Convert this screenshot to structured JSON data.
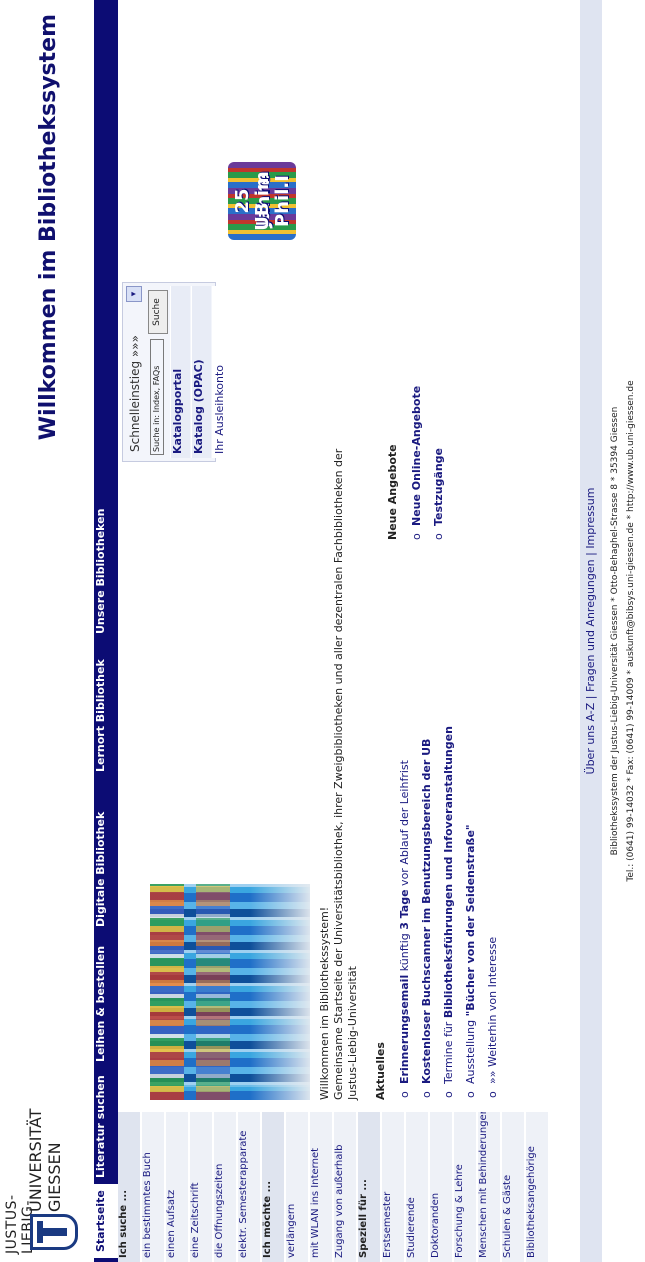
{
  "header": {
    "logo_line1": "JUSTUS-LIEBIG-",
    "logo_line2": "UNIVERSITÄT",
    "logo_line3": "GIESSEN",
    "site_title": "Willkommen im Bibliothekssystem"
  },
  "nav": {
    "tabs": [
      {
        "label": "Startseite"
      },
      {
        "label": "Literatur suchen"
      },
      {
        "label": "Leihen & bestellen"
      },
      {
        "label": "Digitale Bibliothek"
      },
      {
        "label": "Lernort Bibliothek"
      },
      {
        "label": "Unsere Bibliotheken"
      }
    ]
  },
  "sidebar": {
    "items": [
      {
        "label": "Ich suche ..."
      },
      {
        "label": "ein bestimmtes Buch"
      },
      {
        "label": "einen Aufsatz"
      },
      {
        "label": "eine Zeitschrift"
      },
      {
        "label": "die Öffnungszeiten"
      },
      {
        "label": "elektr. Semesterapparate"
      },
      {
        "label": "Ich möchte ..."
      },
      {
        "label": "verlängern"
      },
      {
        "label": "mit WLAN ins Internet"
      },
      {
        "label": "Zugang von außerhalb"
      },
      {
        "label": "Speziell für ..."
      },
      {
        "label": "Erstsemester"
      },
      {
        "label": "Studierende"
      },
      {
        "label": "Doktoranden"
      },
      {
        "label": "Forschung & Lehre"
      },
      {
        "label": "Menschen mit Behinderungen"
      },
      {
        "label": "Schulen & Gäste"
      },
      {
        "label": "Bibliotheksangehörige"
      }
    ]
  },
  "main": {
    "intro_line1": "Willkommen im Bibliothekssystem!",
    "intro_line2": "Gemeinsame Startseite der Universitätsbibliothek, ihrer Zweigbibliotheken und aller dezentralen Fachbibliotheken der",
    "intro_line3": "Justus-Liebig-Universität",
    "news_heading": "Aktuelles",
    "news": [
      {
        "bold": "Erinnerungsemail",
        "mid": " künftig ",
        "bold2": "3 Tage",
        "rest": " vor Ablauf der Leihfrist"
      },
      {
        "bold": "Kostenloser Buchscanner im Benutzungsbereich der UB",
        "mid": "",
        "bold2": "",
        "rest": ""
      },
      {
        "bold": "",
        "mid": "Termine für ",
        "bold2": "Bibliotheksführungen und Infoveranstaltungen",
        "rest": ""
      },
      {
        "bold": "",
        "mid": "Ausstellung ",
        "bold2": "\"Bücher von der Seidenstraße\"",
        "rest": ""
      },
      {
        "bold": "",
        "mid": "»» Weiterhin von Interesse",
        "bold2": "",
        "rest": ""
      }
    ],
    "offers_heading": "Neue Angebote",
    "offers": [
      {
        "label": "Neue Online-Angebote"
      },
      {
        "label": "Testzugänge"
      }
    ]
  },
  "quick": {
    "label": "Schnelleinstieg »»»",
    "input_value": "Suche in: Index, FAQs",
    "button_label": "Suche",
    "links": [
      {
        "label": "Katalogportal"
      },
      {
        "label": "Katalog (OPAC)"
      },
      {
        "label": "Ihr Ausleihkonto"
      }
    ],
    "badge_line1": "25 Jahre",
    "badge_line2": "UB im",
    "badge_line3": "Phil.I"
  },
  "footer": {
    "links": "Über uns A-Z | Fragen und Anregungen | Impressum",
    "address1": "Bibliothekssystem der Justus-Liebig-Universität Giessen * Otto-Behaghel-Strasse 8 * 35394 Giessen",
    "address2": "Tel.: (0641) 99-14032 * Fax: (0641) 99-14009 * auskunft@bibsys.uni-giessen.de * http://www.ub.uni-giessen.de"
  },
  "colors": {
    "nav_bg": "#0c0c74",
    "title_color": "#10106e",
    "link_color": "#1a1a80",
    "sidebar_head_bg": "#dfe4ef"
  }
}
